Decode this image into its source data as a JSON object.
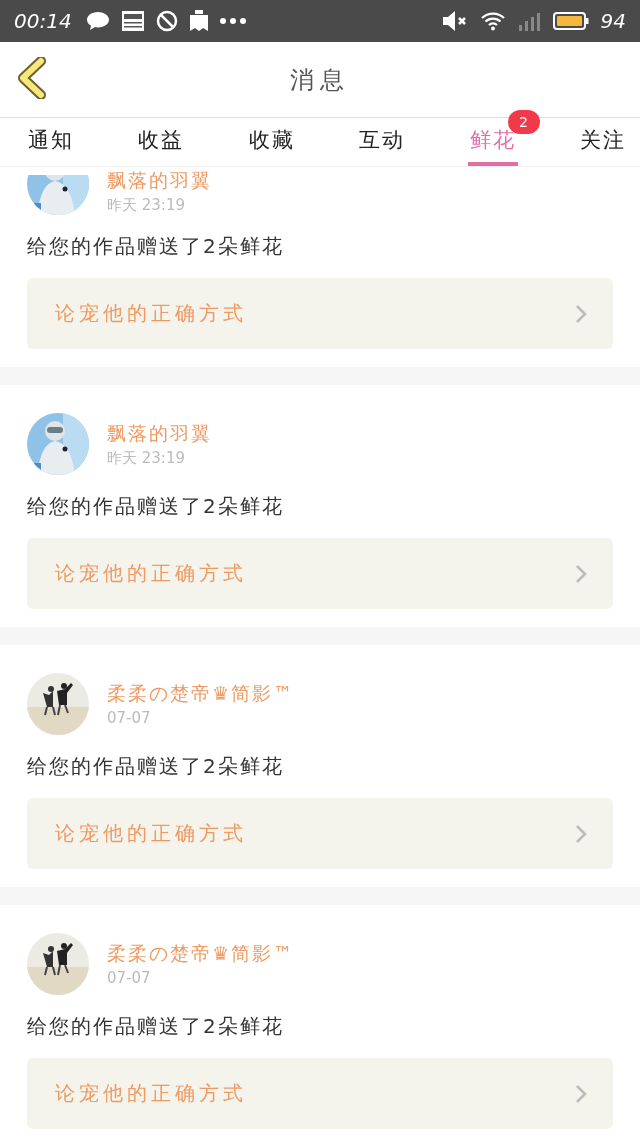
{
  "status_bar": {
    "time": "00:14",
    "battery_percent": "94"
  },
  "header": {
    "title": "消息"
  },
  "tabs": [
    {
      "label": "通知",
      "selected": false
    },
    {
      "label": "收益",
      "selected": false
    },
    {
      "label": "收藏",
      "selected": false
    },
    {
      "label": "互动",
      "selected": false
    },
    {
      "label": "鲜花",
      "selected": true,
      "badge": "2"
    },
    {
      "label": "关注",
      "selected": false
    }
  ],
  "messages": [
    {
      "user": "飘落的羽翼",
      "time": "昨天 23:19",
      "text": "给您的作品赠送了2朵鲜花",
      "work_link": "论宠他的正确方式"
    },
    {
      "user": "飘落的羽翼",
      "time": "昨天 23:19",
      "text": "给您的作品赠送了2朵鲜花",
      "work_link": "论宠他的正确方式"
    },
    {
      "user": "柔柔の楚帝♛简影™",
      "time": "07-07",
      "text": "给您的作品赠送了2朵鲜花",
      "work_link": "论宠他的正确方式"
    },
    {
      "user": "柔柔の楚帝♛简影™",
      "time": "07-07",
      "text": "给您的作品赠送了2朵鲜花",
      "work_link": "论宠他的正确方式"
    }
  ]
}
